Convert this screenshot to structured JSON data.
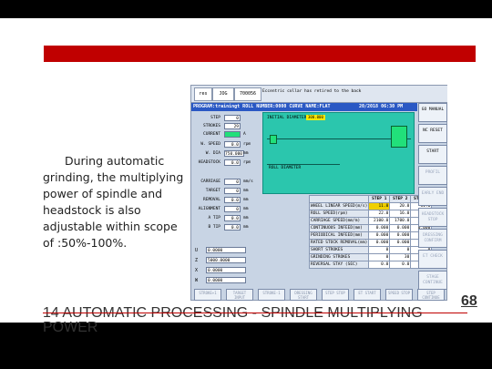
{
  "slide": {
    "body_lines": [
      "During automatic",
      "grinding, the multiplying",
      "power of spindle and",
      "headstock is also",
      "adjustable within scope",
      "of :50%-100%."
    ],
    "footer_line1": "14 AUTOMATIC PROCESSING - SPINDLE MULTIPLYING",
    "footer_line2": "POWER",
    "page_number": "68"
  },
  "screen": {
    "header": {
      "mode": "res",
      "jog": "JOG",
      "value": "700056",
      "message": "Eccentric collar has retired to the back"
    },
    "program_bar": "PROGRAM:trainingt  ROLL NUMBER:0000  CURVE NAME:FLAT",
    "datetime": "20/2018 06:30 PM",
    "params": [
      {
        "label": "STEP",
        "value": "0",
        "unit": ""
      },
      {
        "label": "STROKES",
        "value": "29",
        "unit": ""
      },
      {
        "label": "CURRENT",
        "value": "",
        "unit": "A"
      },
      {
        "label": "W. SPEED",
        "value": "0.0",
        "unit": "rpm"
      },
      {
        "label": "W. DIA",
        "value": "750.000",
        "unit": "mm"
      },
      {
        "label": "HEADSTOCK",
        "value": "0.0",
        "unit": "rpm"
      },
      {
        "label": "CARRIAGE",
        "value": "0",
        "unit": "mm/s"
      },
      {
        "label": "TARGET",
        "value": "0",
        "unit": "mm"
      },
      {
        "label": "REMOVAL",
        "value": "0.0",
        "unit": "mm"
      },
      {
        "label": "ALIGNMENT",
        "value": "0",
        "unit": "mm"
      },
      {
        "label": "A TIP",
        "value": "0.0",
        "unit": "mm"
      },
      {
        "label": "B TIP",
        "value": "0.0",
        "unit": "mm"
      }
    ],
    "graphic": {
      "initial_diameter_label": "INITIAL DIAMETER",
      "initial_diameter_value": "300.000",
      "roll_diameter_label": "ROLL DIAMETER"
    },
    "axes": [
      {
        "name": "U",
        "value": "0.0000"
      },
      {
        "name": "Z",
        "value": "5000.0000"
      },
      {
        "name": "X",
        "value": "0.0000"
      },
      {
        "name": "W",
        "value": "0.0000"
      }
    ],
    "step_table": {
      "headers": [
        "",
        "STEP 1",
        "STEP 2",
        "STEP 3",
        "ST"
      ],
      "rows": [
        {
          "name": "WHEEL LINEAR SPEED(m/s)",
          "values": [
            "11.0",
            "20.0",
            "11.0"
          ]
        },
        {
          "name": "ROLL SPEED(rpm)",
          "values": [
            "22.0",
            "16.0",
            "11.0"
          ]
        },
        {
          "name": "CARRIAGE SPEED(mm/m)",
          "values": [
            "2100.0",
            "1700.0",
            "800.0"
          ]
        },
        {
          "name": "CONTINUOUS INFEED(mm)",
          "values": [
            "0.000",
            "0.000",
            "0.000"
          ]
        },
        {
          "name": "PERIODICAL INFEED(mm)",
          "values": [
            "0.000",
            "0.000",
            "0.000"
          ]
        },
        {
          "name": "RATED STOCK REMOVAL(mm)",
          "values": [
            "0.000",
            "0.000",
            "0.000"
          ]
        },
        {
          "name": "SHORT STROKES",
          "values": [
            "0",
            "0",
            "0"
          ]
        },
        {
          "name": "GRINDING STROKES",
          "values": [
            "0",
            "30",
            "30"
          ]
        },
        {
          "name": "REVERSAL STAY (SEC)",
          "values": [
            "0.0",
            "0.0",
            "0.0"
          ]
        }
      ]
    },
    "right_buttons": [
      {
        "label": "GO MANUAL",
        "enabled": true
      },
      {
        "label": "NC RESET",
        "enabled": true
      },
      {
        "label": "START",
        "enabled": true
      },
      {
        "label": "PROFIL",
        "enabled": false
      },
      {
        "label": "EARLY END",
        "enabled": false
      },
      {
        "label": "HEADSTOCK STOP",
        "enabled": false
      },
      {
        "label": "DRESSING CONFIRM",
        "enabled": false
      },
      {
        "label": "ET CHECK",
        "enabled": false
      },
      {
        "label": "STAGE CONTINUE",
        "enabled": false
      }
    ],
    "bottom_buttons": [
      "STROKE+1",
      "TARGET INPUT",
      "STROKE-1",
      "DRESSING START",
      "STEP STOP",
      "ET START",
      "SPEED STOP",
      "STEP CONTINUE"
    ]
  },
  "colors": {
    "accent_red": "#c00000",
    "program_bar": "#2a58c4",
    "graphic_bg": "#2bc6ad",
    "selected_cell": "#f0d000"
  }
}
